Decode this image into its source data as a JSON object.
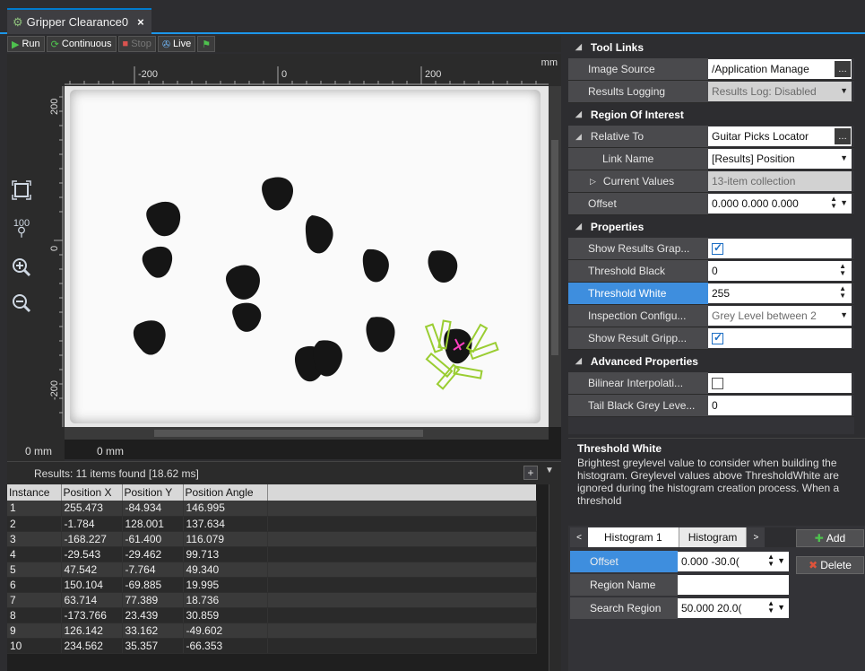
{
  "tab": {
    "title": "Gripper Clearance0",
    "close": "×"
  },
  "toolbar": {
    "run": "Run",
    "continuous": "Continuous",
    "stop": "Stop",
    "live": "Live"
  },
  "viewer": {
    "unit": "mm",
    "ruler_x": [
      "-200",
      "0",
      "200"
    ],
    "ruler_y": [
      "200",
      "0",
      "-200"
    ],
    "coord_x": "0 mm",
    "coord_y": "0 mm",
    "zoom_label": "100"
  },
  "results": {
    "summary": "Results: 11 items found [18.62 ms]",
    "columns": [
      "Instance",
      "Position X",
      "Position Y",
      "Position Angle"
    ],
    "rows": [
      [
        "1",
        "255.473",
        "-84.934",
        "146.995"
      ],
      [
        "2",
        "-1.784",
        "128.001",
        "137.634"
      ],
      [
        "3",
        "-168.227",
        "-61.400",
        "116.079"
      ],
      [
        "4",
        "-29.543",
        "-29.462",
        "99.713"
      ],
      [
        "5",
        "47.542",
        "-7.764",
        "49.340"
      ],
      [
        "6",
        "150.104",
        "-69.885",
        "19.995"
      ],
      [
        "7",
        "63.714",
        "77.389",
        "18.736"
      ],
      [
        "8",
        "-173.766",
        "23.439",
        "30.859"
      ],
      [
        "9",
        "126.142",
        "33.162",
        "-49.602"
      ],
      [
        "10",
        "234.562",
        "35.357",
        "-66.353"
      ]
    ]
  },
  "properties": {
    "tool_links": "Tool Links",
    "image_source_label": "Image Source",
    "image_source_value": "/Application Manage",
    "results_logging_label": "Results Logging",
    "results_logging_value": "Results Log: Disabled",
    "roi": "Region Of Interest",
    "relative_to_label": "Relative To",
    "relative_to_value": "Guitar Picks Locator",
    "link_name_label": "Link Name",
    "link_name_value": "[Results] Position",
    "current_values_label": "Current Values",
    "current_values_value": "13-item collection",
    "offset_label": "Offset",
    "offset_value": "0.000 0.000 0.000",
    "props": "Properties",
    "show_results_graphics_label": "Show Results Grap...",
    "threshold_black_label": "Threshold Black",
    "threshold_black_value": "0",
    "threshold_white_label": "Threshold White",
    "threshold_white_value": "255",
    "inspection_config_label": "Inspection Configu...",
    "inspection_config_value": "Grey Level between 2",
    "show_result_gripper_label": "Show Result Gripp...",
    "advanced": "Advanced Properties",
    "bilinear_label": "Bilinear Interpolati...",
    "tail_black_label": "Tail Black Grey Leve...",
    "tail_black_value": "0"
  },
  "description": {
    "title": "Threshold White",
    "text": "Brightest greylevel value to consider when building the histogram. Greylevel values above ThresholdWhite are ignored during the histogram creation process. When a threshold"
  },
  "histogram": {
    "tab1": "Histogram 1",
    "tab2": "Histogram",
    "add": "Add",
    "delete": "Delete",
    "offset_label": "Offset",
    "offset_value": "0.000 -30.0(",
    "region_name_label": "Region Name",
    "region_name_value": "",
    "search_region_label": "Search Region",
    "search_region_value": "50.000 20.0("
  },
  "colors": {
    "accent": "#1c97ea",
    "selected": "#3e8ede",
    "gripper": "#9acd32"
  }
}
